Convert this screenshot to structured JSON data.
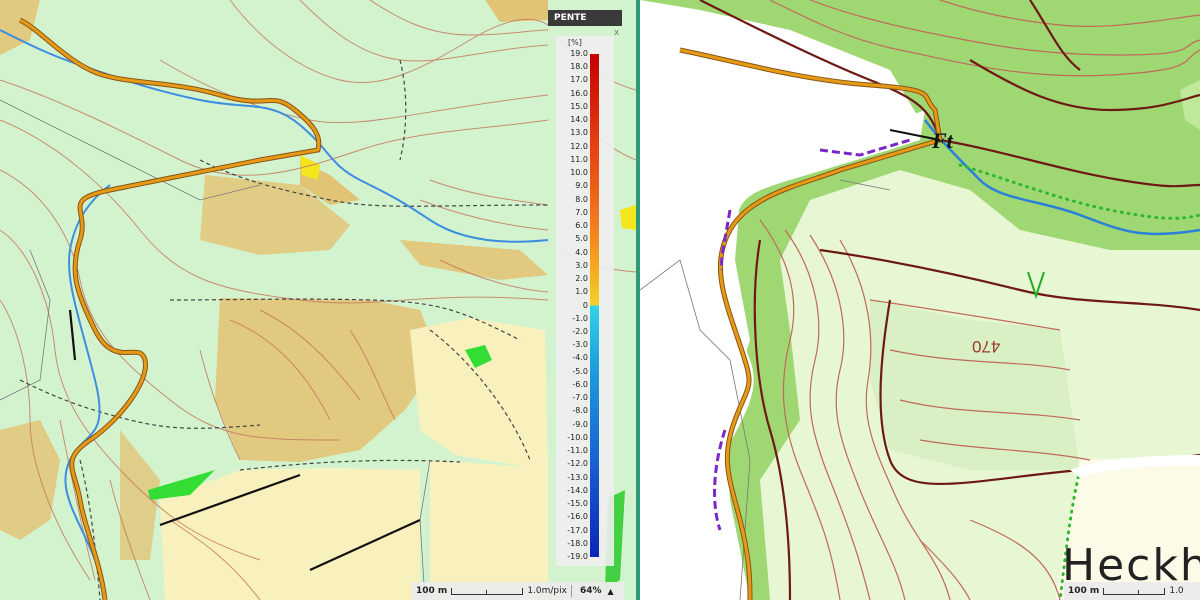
{
  "left_panel": {
    "legend": {
      "title": "PENTE",
      "close": "x",
      "unit": "[%]",
      "ticks": [
        "19.0",
        "18.0",
        "17.0",
        "16.0",
        "15.0",
        "14.0",
        "13.0",
        "12.0",
        "11.0",
        "10.0",
        "9.0",
        "8.0",
        "7.0",
        "6.0",
        "5.0",
        "4.0",
        "3.0",
        "2.0",
        "1.0",
        "0",
        "-1.0",
        "-2.0",
        "-3.0",
        "-4.0",
        "-5.0",
        "-6.0",
        "-7.0",
        "-8.0",
        "-9.0",
        "-10.0",
        "-11.0",
        "-12.0",
        "-13.0",
        "-14.0",
        "-15.0",
        "-16.0",
        "-17.0",
        "-18.0",
        "-19.0"
      ],
      "colors": {
        "top": "#c40000",
        "middle_pos": "#f3d12a",
        "middle_neg": "#33d2ea",
        "bottom": "#0c24b8"
      }
    },
    "status_bar": {
      "scale": "100 m",
      "resolution": "1.0m/pix",
      "zoom": "64%",
      "arrow": "▲"
    }
  },
  "right_panel": {
    "labels": {
      "feature_code": "Ft",
      "elevation": "470",
      "place_name": "Heckh"
    },
    "status_bar": {
      "scale": "100 m",
      "resolution": "1.0"
    }
  },
  "colors": {
    "left_background": "#d3f3cf",
    "slope_fill": "#e2c477",
    "field_fill": "#f9f1bd",
    "contour": "#c57a5d",
    "route": "#e59a16",
    "stream": "#3c8ee0",
    "forest_light": "#e7f6d3",
    "forest_dark": "#9fd773",
    "contour_dark": "#6e1a14"
  }
}
